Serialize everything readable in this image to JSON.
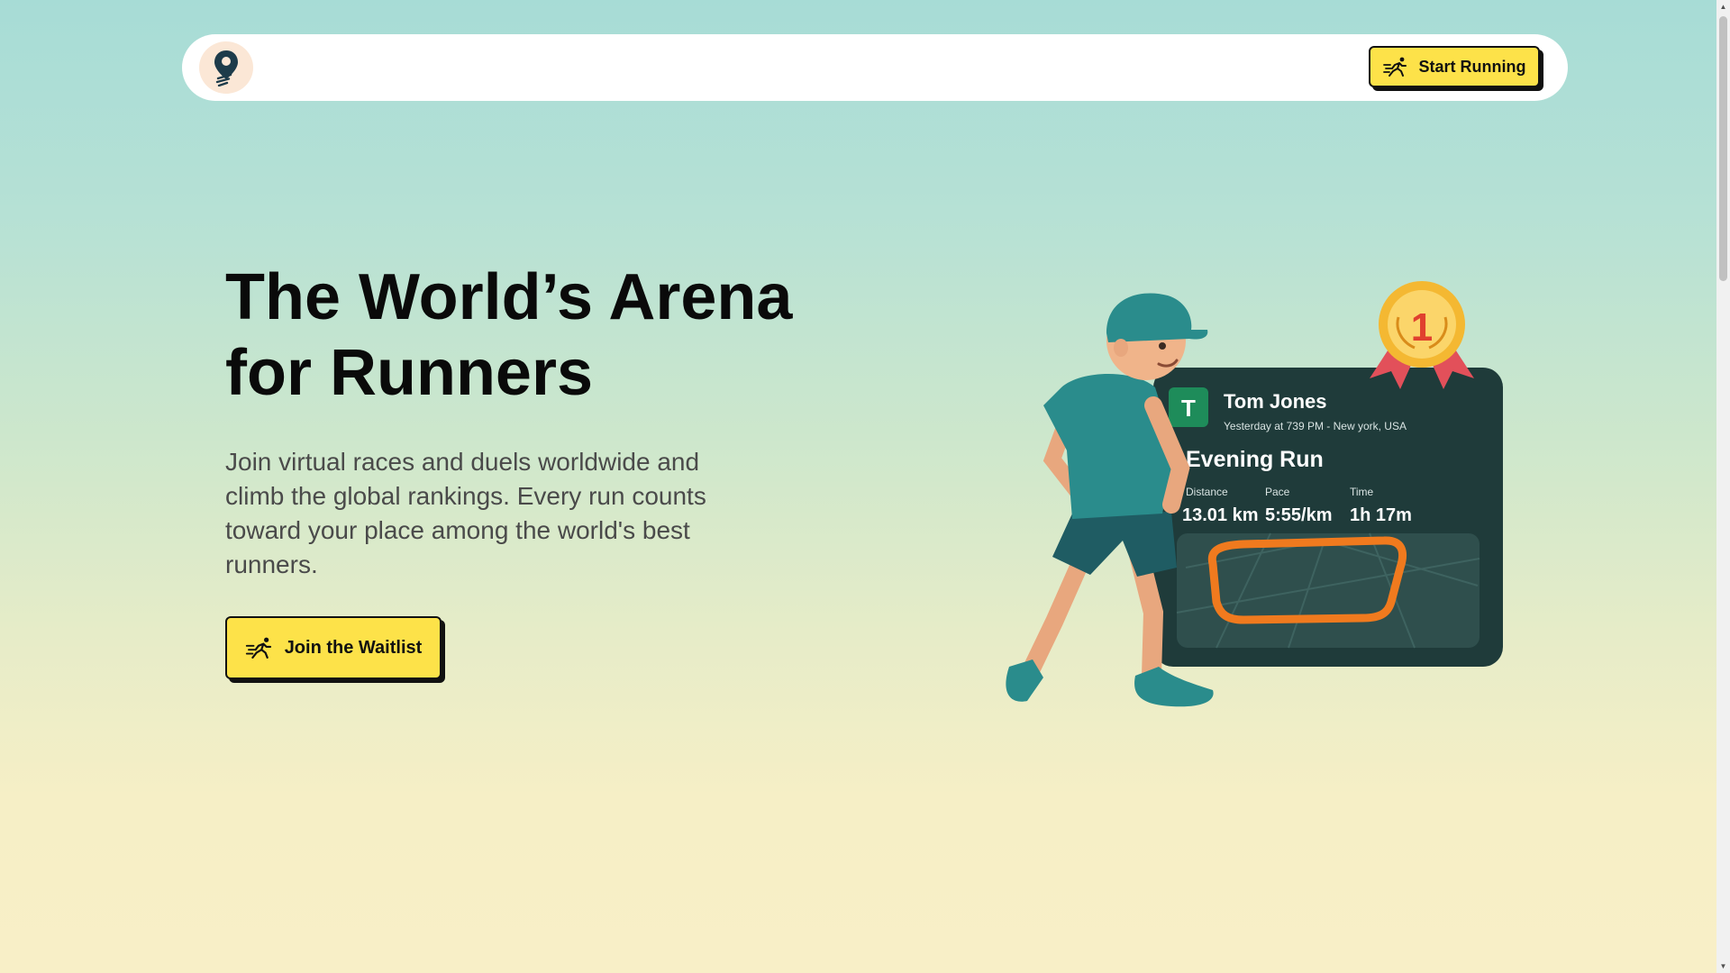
{
  "nav": {
    "logo_icon": "location-pin-runner-icon",
    "cta_label": "Start Running",
    "cta_icon": "running-person-icon"
  },
  "hero": {
    "title_line1": "The World’s Arena",
    "title_line2": "for Runners",
    "subtitle": "Join virtual races and duels worldwide and climb the global rankings. Every run counts toward your place among the world's best runners.",
    "cta_label": "Join the Waitlist",
    "cta_icon": "running-person-icon"
  },
  "illustration": {
    "badge": "1",
    "card": {
      "avatar_letter": "T",
      "name": "Tom Jones",
      "meta": "Yesterday at 739 PM - New york, USA",
      "activity": "Evening Run",
      "stats": [
        {
          "label": "Distance",
          "value": "13.01 km"
        },
        {
          "label": "Pace",
          "value": "5:55/km"
        },
        {
          "label": "Time",
          "value": "1h 17m"
        }
      ]
    }
  },
  "colors": {
    "accent_yellow": "#fde249",
    "card_dark": "#1f3b3a",
    "route_orange": "#f07a1e",
    "shirt_teal": "#2a8c8c"
  }
}
